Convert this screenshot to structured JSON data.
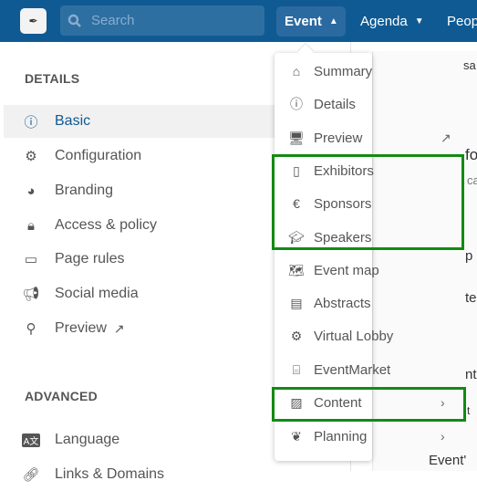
{
  "topbar": {
    "logo_icon": "event-logo",
    "search_placeholder": "Search",
    "nav": [
      {
        "label": "Event",
        "icon": "chevron-up-icon"
      },
      {
        "label": "Agenda",
        "icon": "chevron-down-icon"
      },
      {
        "label": "Peop"
      }
    ]
  },
  "sidebar": {
    "details_heading": "DETAILS",
    "details_items": [
      {
        "label": "Basic",
        "icon": "info-icon",
        "active": true
      },
      {
        "label": "Configuration",
        "icon": "gear-icon"
      },
      {
        "label": "Branding",
        "icon": "palette-icon"
      },
      {
        "label": "Access & policy",
        "icon": "lock-icon"
      },
      {
        "label": "Page rules",
        "icon": "window-icon"
      },
      {
        "label": "Social media",
        "icon": "megaphone-icon"
      },
      {
        "label": "Preview",
        "icon": "search-icon"
      }
    ],
    "advanced_heading": "ADVANCED",
    "advanced_items": [
      {
        "label": "Language",
        "icon": "language-icon"
      },
      {
        "label": "Links & Domains",
        "icon": "link-icon"
      }
    ]
  },
  "background_fragments": [
    "sa",
    "fo",
    "ca",
    "p",
    "te",
    "nt",
    "t",
    "Event'"
  ],
  "dropdown": {
    "items": [
      {
        "label": "Summary",
        "icon": "home-icon"
      },
      {
        "label": "Details",
        "icon": "info-icon"
      },
      {
        "label": "Preview",
        "icon": "monitor-icon",
        "trailing": "external-link-icon"
      },
      {
        "label": "Exhibitors",
        "icon": "book-icon"
      },
      {
        "label": "Sponsors",
        "icon": "euro-icon"
      },
      {
        "label": "Speakers",
        "icon": "graduation-cap-icon"
      },
      {
        "label": "Event map",
        "icon": "map-icon"
      },
      {
        "label": "Abstracts",
        "icon": "document-icon"
      },
      {
        "label": "Virtual Lobby",
        "icon": "gears-icon"
      },
      {
        "label": "EventMarket",
        "icon": "store-icon"
      },
      {
        "label": "Content",
        "icon": "images-icon",
        "trailing": "chevron-right-icon"
      },
      {
        "label": "Planning",
        "icon": "leaf-icon",
        "trailing": "chevron-right-icon"
      }
    ]
  },
  "colors": {
    "topbar": "#0f5a93",
    "highlight": "#138a13"
  }
}
